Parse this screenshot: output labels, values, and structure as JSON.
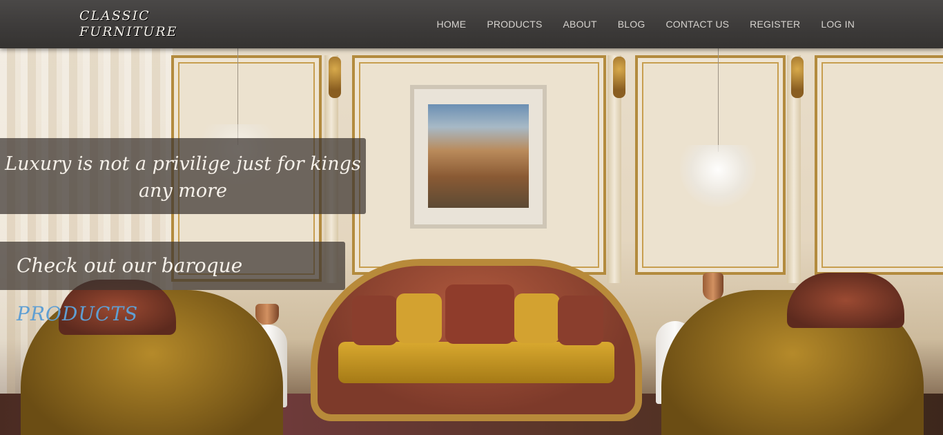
{
  "brand": {
    "logo_text": "CLASSIC FURNITURE"
  },
  "nav": {
    "items": [
      {
        "label": "HOME"
      },
      {
        "label": "PRODUCTS"
      },
      {
        "label": "ABOUT"
      },
      {
        "label": "BLOG"
      },
      {
        "label": "CONTACT US"
      },
      {
        "label": "REGISTER"
      },
      {
        "label": "LOG IN"
      }
    ]
  },
  "hero": {
    "tagline": "Luxury is not a privilige just for kings any more",
    "cta_prefix": "Check out our baroque",
    "cta_link": "PRODUCTS"
  },
  "colors": {
    "navbar": "#3c3a39",
    "nav_text": "#d6d3cf",
    "cta_link": "#5f9fd3",
    "caption_bg": "rgba(60,52,48,.72)"
  }
}
